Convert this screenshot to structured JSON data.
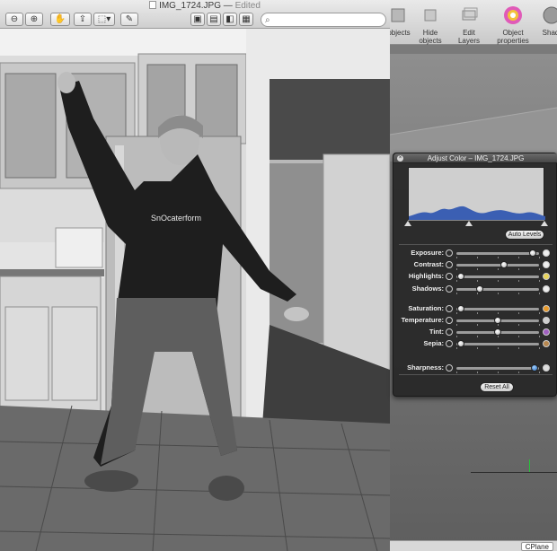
{
  "preview": {
    "title": "IMG_1724.JPG",
    "title_suffix": "Edited",
    "search_placeholder": "",
    "toolbar": [
      {
        "name": "zoom-out-icon",
        "glyph": "−"
      },
      {
        "name": "zoom-in-icon",
        "glyph": "+"
      },
      {
        "name": "move-hand-icon",
        "glyph": "✋"
      },
      {
        "name": "share-icon",
        "glyph": "⇪"
      },
      {
        "name": "selection-tools-icon",
        "glyph": "⬚"
      },
      {
        "name": "annotate-pencil-icon",
        "glyph": "✎"
      },
      {
        "name": "view-single-icon",
        "glyph": "▣"
      },
      {
        "name": "view-thumbnails-icon",
        "glyph": "▤"
      },
      {
        "name": "view-sidebar-icon",
        "glyph": "◧"
      },
      {
        "name": "view-contact-sheet-icon",
        "glyph": "▦"
      }
    ]
  },
  "background_app": {
    "tools": [
      {
        "label": "objects",
        "icon": "objects-icon"
      },
      {
        "label": "Hide objects",
        "icon": "hide-objects-icon"
      },
      {
        "label": "Edit Layers",
        "icon": "edit-layers-icon"
      },
      {
        "label": "Object properties",
        "icon": "object-properties-icon"
      },
      {
        "label": "Shad",
        "icon": "shadow-icon"
      }
    ],
    "status_right": "CPlane"
  },
  "adjust_color": {
    "title": "Adjust Color – IMG_1724.JPG",
    "auto_levels_label": "Auto Levels",
    "reset_all_label": "Reset All",
    "levels": {
      "black_point": 0.0,
      "mid_point": 0.45,
      "white_point": 1.0
    },
    "histogram_color": "#3b5fb3",
    "sliders": [
      {
        "label": "Exposure:",
        "value": 0.92
      },
      {
        "label": "Contrast:",
        "value": 0.58
      },
      {
        "label": "Highlights:",
        "value": 0.05
      },
      {
        "label": "Shadows:",
        "value": 0.28
      },
      {
        "label": "Saturation:",
        "value": 0.05
      },
      {
        "label": "Temperature:",
        "value": 0.5
      },
      {
        "label": "Tint:",
        "value": 0.5
      },
      {
        "label": "Sepia:",
        "value": 0.05
      },
      {
        "label": "Sharpness:",
        "value": 0.95
      }
    ]
  },
  "colors": {
    "hud_bg": "#2b2b2b",
    "slider_track": "#9b9b9b"
  }
}
